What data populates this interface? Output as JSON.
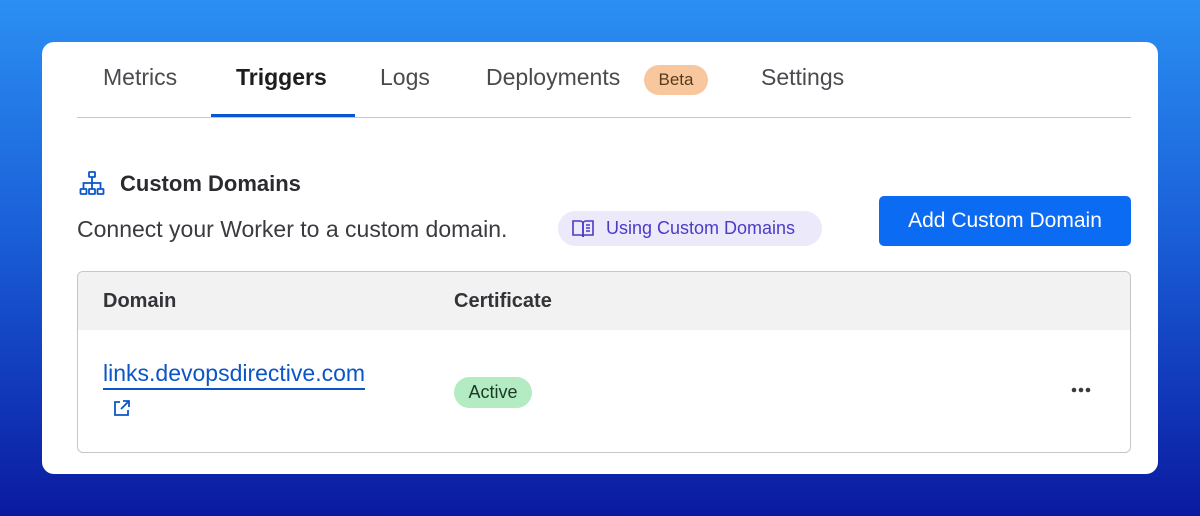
{
  "tabs": {
    "metrics": "Metrics",
    "triggers": "Triggers",
    "logs": "Logs",
    "deployments": "Deployments",
    "deployments_badge": "Beta",
    "settings": "Settings",
    "active_tab": "Triggers"
  },
  "section": {
    "title": "Custom Domains",
    "description": "Connect your Worker to a custom domain.",
    "doc_link_label": "Using Custom Domains",
    "add_button": "Add Custom Domain",
    "icon": "sitemap-icon"
  },
  "table": {
    "columns": [
      "Domain",
      "Certificate"
    ],
    "rows": [
      {
        "domain": "links.devopsdirective.com",
        "certificate": "Active"
      }
    ]
  },
  "colors": {
    "accent": "#0b6bf2",
    "tab_active_underline": "#0a55d3",
    "badge_beta_bg": "#f8c79e",
    "status_active_bg": "#b3ebc3",
    "doc_pill_bg": "#ece9fb",
    "link": "#0a55c9"
  }
}
